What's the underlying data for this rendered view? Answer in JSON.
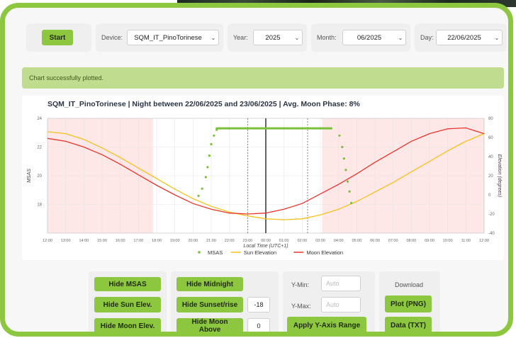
{
  "header": {
    "start_label": "Start",
    "device_label": "Device:",
    "device_value": "SQM_IT_PinoTorinese",
    "year_label": "Year:",
    "year_value": "2025",
    "month_label": "Month:",
    "month_value": "06/2025",
    "day_label": "Day:",
    "day_value": "22/06/2025"
  },
  "alert_text": "Chart successfully plotted.",
  "chart_data": {
    "type": "line",
    "title": "SQM_IT_PinoTorinese | Night between 22/06/2025 and 23/06/2025 | Avg. Moon Phase: 8%",
    "xlabel": "Local Time (UTC+1)",
    "ylabel": "MSAS",
    "y2label": "Elevation (degrees)",
    "x_ticks": [
      "12:00",
      "13:00",
      "14:00",
      "15:00",
      "16:00",
      "17:00",
      "18:00",
      "19:00",
      "20:00",
      "21:00",
      "22:00",
      "23:00",
      "00:00",
      "01:00",
      "02:00",
      "03:00",
      "04:00",
      "05:00",
      "06:00",
      "07:00",
      "08:00",
      "09:00",
      "10:00",
      "11:00",
      "12:00"
    ],
    "ylim": [
      16,
      24
    ],
    "y_ticks": [
      24,
      22,
      20,
      18
    ],
    "y2lim": [
      -40,
      80
    ],
    "y2_ticks": [
      80,
      60,
      40,
      20,
      0,
      -20,
      -40
    ],
    "grid": true,
    "legend_placement": "bottom",
    "series": [
      {
        "name": "MSAS",
        "color": "#7bbf3a",
        "style": "dots",
        "x": [
          20.3,
          20.5,
          20.7,
          20.8,
          20.9,
          21.0,
          21.15,
          21.3,
          21.5,
          22.0,
          23.0,
          24.0,
          25.0,
          26.0,
          27.0,
          27.6,
          28.05,
          28.2,
          28.3,
          28.4,
          28.5,
          28.6,
          28.7
        ],
        "values": [
          18.6,
          19.1,
          19.9,
          20.6,
          21.4,
          22.2,
          22.8,
          23.2,
          23.3,
          23.3,
          23.3,
          23.3,
          23.3,
          23.3,
          23.3,
          23.3,
          22.8,
          22.0,
          21.2,
          20.4,
          19.6,
          18.9,
          18.1
        ]
      },
      {
        "name": "Sun Elevation",
        "color": "#f5c21b",
        "style": "line",
        "x": [
          12,
          13,
          14,
          15,
          16,
          17,
          18,
          19,
          20,
          21,
          22,
          23,
          24,
          25,
          26,
          27,
          28,
          29,
          30,
          31,
          32,
          33,
          34,
          35,
          36
        ],
        "values": [
          66,
          64,
          58,
          49,
          39,
          28,
          17,
          6,
          -4,
          -12,
          -18,
          -22,
          -25,
          -26,
          -25,
          -21,
          -15,
          -7,
          3,
          13,
          24,
          35,
          46,
          56,
          64
        ]
      },
      {
        "name": "Moon Elevation",
        "color": "#e8342a",
        "style": "line",
        "x": [
          12,
          13,
          14,
          15,
          16,
          17,
          18,
          19,
          20,
          21,
          22,
          23,
          24,
          25,
          26,
          27,
          28,
          29,
          30,
          31,
          32,
          33,
          34,
          35,
          36
        ],
        "values": [
          59,
          56,
          50,
          42,
          32,
          21,
          10,
          0,
          -9,
          -15,
          -19,
          -20,
          -19,
          -15,
          -9,
          1,
          11,
          22,
          34,
          45,
          56,
          64,
          69,
          70,
          64
        ]
      }
    ],
    "shaded_regions": [
      [
        12,
        17.8
      ],
      [
        27.1,
        36
      ]
    ],
    "markers": {
      "midnight": 24.0,
      "sunset_sunrise": [
        23.0,
        26.3
      ]
    }
  },
  "controls": {
    "hide_msas": "Hide MSAS",
    "hide_sun": "Hide Sun Elev.",
    "hide_moon": "Hide Moon Elev.",
    "hide_midnight": "Hide Midnight",
    "hide_sunset": "Hide Sunset/rise",
    "sunset_value": "-18",
    "hide_moon_above": "Hide Moon Above",
    "moon_above_value": "0",
    "ymin_label": "Y-Min:",
    "ymin_placeholder": "Auto",
    "ymax_label": "Y-Max:",
    "ymax_placeholder": "Auto",
    "apply_label": "Apply Y-Axis Range",
    "download_label": "Download",
    "plot_png": "Plot (PNG)",
    "data_txt": "Data (TXT)"
  }
}
